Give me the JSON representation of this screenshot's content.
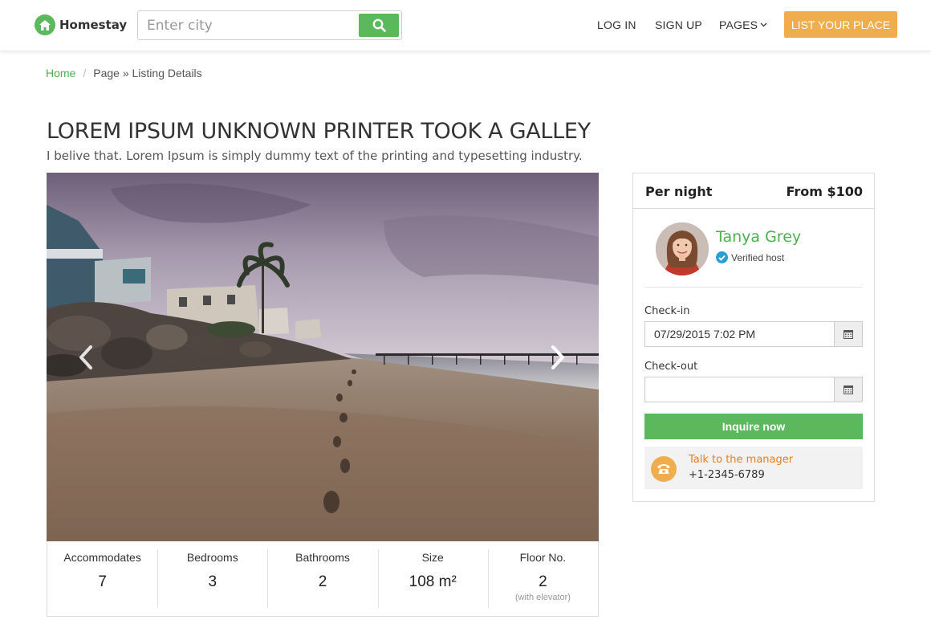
{
  "header": {
    "logo_text": "Homestay",
    "search_placeholder": "Enter city",
    "nav": {
      "login": "LOG IN",
      "signup": "SIGN UP",
      "pages": "PAGES"
    },
    "cta": "LIST YOUR PLACE"
  },
  "breadcrumb": {
    "home": "Home",
    "separator": "/",
    "current": "Page » Listing Details"
  },
  "listing": {
    "title": "LOREM IPSUM UNKNOWN PRINTER TOOK A GALLEY",
    "subtitle": "I belive that. Lorem Ipsum is simply dummy text of the printing and typesetting industry."
  },
  "stats": [
    {
      "label": "Accommodates",
      "value": "7",
      "note": ""
    },
    {
      "label": "Bedrooms",
      "value": "3",
      "note": ""
    },
    {
      "label": "Bathrooms",
      "value": "2",
      "note": ""
    },
    {
      "label": "Size",
      "value": "108 m²",
      "note": ""
    },
    {
      "label": "Floor No.",
      "value": "2",
      "note": "(with elevator)"
    }
  ],
  "booking": {
    "per_night_label": "Per night",
    "price": "From $100",
    "host": {
      "name": "Tanya Grey",
      "verified_label": "Verified host"
    },
    "checkin": {
      "label": "Check-in",
      "value": "07/29/2015 7:02 PM"
    },
    "checkout": {
      "label": "Check-out",
      "value": ""
    },
    "inquire_label": "Inquire now",
    "manager": {
      "title": "Talk to the manager",
      "phone": "+1-2345-6789"
    }
  },
  "colors": {
    "brand_green": "#5cb85c",
    "link_green": "#4caf50",
    "accent_orange": "#f0ad4e",
    "manager_orange": "#e67e22",
    "verified_blue": "#2a9fd6"
  },
  "icons": {
    "logo": "home-icon",
    "search": "search-icon",
    "pages_dropdown": "chevron-down-icon",
    "gallery_prev": "chevron-left-icon",
    "gallery_next": "chevron-right-icon",
    "verified": "check-badge-icon",
    "date_picker": "calendar-icon",
    "phone": "phone-icon"
  }
}
